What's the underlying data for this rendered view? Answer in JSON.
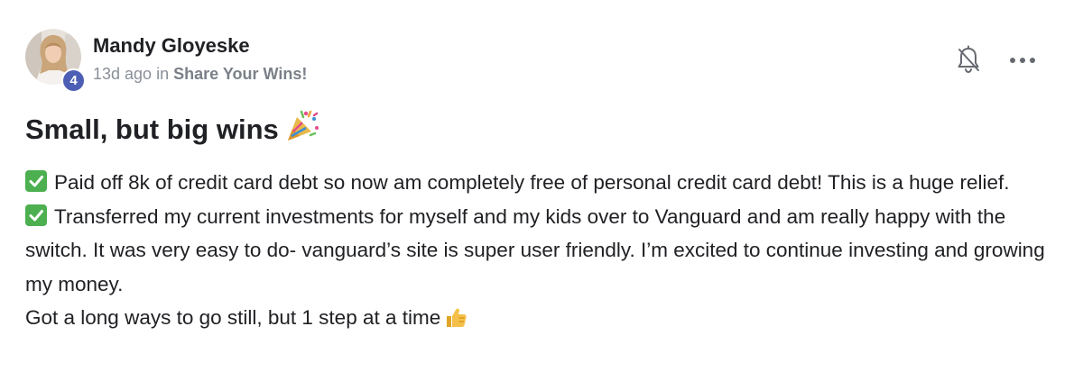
{
  "post": {
    "author": "Mandy Gloyeske",
    "level": "4",
    "time": "13d ago",
    "in_text": "in",
    "group": "Share Your Wins!",
    "title": "Small, but big wins",
    "title_emoji": "party-popper-icon",
    "paragraphs": [
      {
        "icon": "check-mark-icon",
        "text": "Paid off 8k of credit card debt so now am completely free of personal credit card debt! This is a huge relief."
      },
      {
        "icon": "check-mark-icon",
        "text": "Transferred my current investments for myself and my kids over to Vanguard and am really happy with the switch. It was very easy to do- vanguard’s site is super user friendly. I’m excited to continue investing and growing my money."
      },
      {
        "icon": "",
        "text": "Got a long ways to go still, but 1 step at a time",
        "trailing_icon": "thumbs-up-icon"
      }
    ]
  },
  "actions": {
    "notify_icon": "bell-off-icon",
    "more_icon": "more-dots-icon"
  },
  "colors": {
    "badge": "#4d5fb5",
    "check": "#4caf50",
    "text": "#202124",
    "muted": "#8a8f98"
  }
}
